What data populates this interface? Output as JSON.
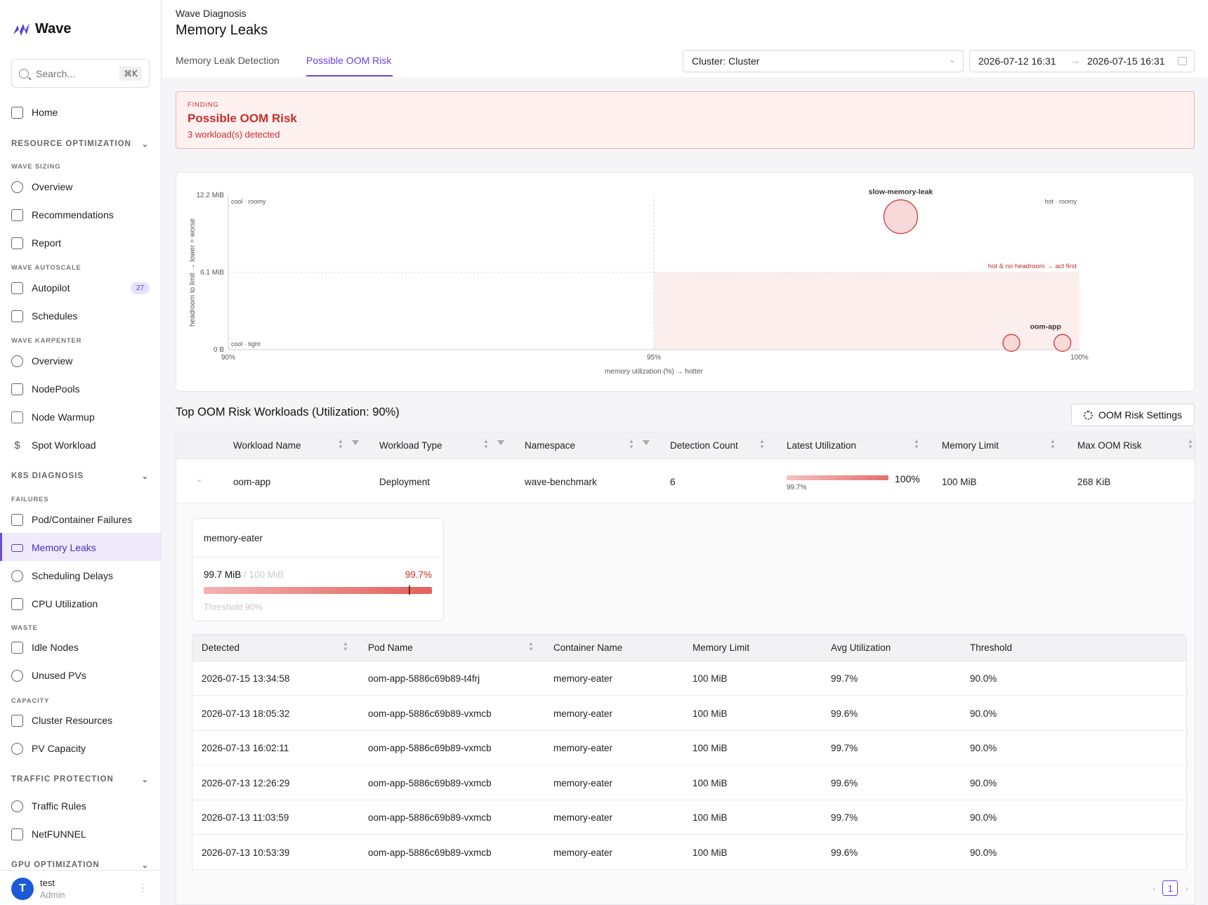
{
  "app": {
    "name": "Wave"
  },
  "search": {
    "placeholder": "Search...",
    "shortcut": "⌘K"
  },
  "sidebar": {
    "home": "Home",
    "resource_opt": "RESOURCE OPTIMIZATION",
    "wave_sizing": "WAVE SIZING",
    "overview1": "Overview",
    "recommendations": "Recommendations",
    "report": "Report",
    "wave_autoscale": "WAVE AUTOSCALE",
    "autopilot": "Autopilot",
    "autopilot_badge": "27",
    "schedules": "Schedules",
    "wave_karpenter": "WAVE KARPENTER",
    "overview2": "Overview",
    "nodepools": "NodePools",
    "node_warmup": "Node Warmup",
    "spot_workload": "Spot Workload",
    "k8s_diag": "K8S DIAGNOSIS",
    "failures": "FAILURES",
    "pod_failures": "Pod/Container Failures",
    "memory_leaks": "Memory Leaks",
    "scheduling_delays": "Scheduling Delays",
    "cpu_util": "CPU Utilization",
    "waste": "WASTE",
    "idle_nodes": "Idle Nodes",
    "unused_pvs": "Unused PVs",
    "capacity": "CAPACITY",
    "cluster_resources": "Cluster Resources",
    "pv_capacity": "PV Capacity",
    "traffic_protection": "TRAFFIC PROTECTION",
    "traffic_rules": "Traffic Rules",
    "netfunnel": "NetFUNNEL",
    "gpu_opt": "GPU OPTIMIZATION"
  },
  "user": {
    "initial": "T",
    "name": "test",
    "role": "Admin"
  },
  "header": {
    "breadcrumb": "Wave Diagnosis",
    "title": "Memory Leaks",
    "tabs": [
      "Memory Leak Detection",
      "Possible OOM Risk"
    ],
    "cluster": "Cluster: Cluster",
    "date_from": "2026-07-12 16:31",
    "date_to": "2026-07-15 16:31"
  },
  "finding": {
    "label": "FINDING",
    "title": "Possible OOM Risk",
    "subtitle": "3 workload(s) detected"
  },
  "chart_data": {
    "type": "scatter",
    "xlabel": "memory utilization (%) → hotter",
    "ylabel": "headroom to limit → lower = worse",
    "x_ticks": [
      "90%",
      "95%",
      "100%"
    ],
    "y_ticks": [
      "0 B",
      "6.1 MiB",
      "12.2 MiB"
    ],
    "xlim": [
      90,
      100
    ],
    "ylim": [
      0,
      12.2
    ],
    "quadrant_labels": {
      "top_left": "cool · roomy",
      "top_right": "hot · roomy",
      "bottom_left": "cool · tight",
      "danger": "hot & no headroom → act first"
    },
    "points": [
      {
        "label": "slow-memory-leak",
        "x": 97.9,
        "y": 10.5,
        "size": "large"
      },
      {
        "label": "",
        "x": 99.2,
        "y": 0.2,
        "size": "small"
      },
      {
        "label": "oom-app",
        "x": 99.8,
        "y": 0.2,
        "size": "small"
      }
    ]
  },
  "workloads": {
    "title": "Top OOM Risk Workloads (Utilization: 90%)",
    "settings_label": "OOM Risk Settings",
    "columns": [
      "Workload Name",
      "Workload Type",
      "Namespace",
      "Detection Count",
      "Latest Utilization",
      "Memory Limit",
      "Max OOM Risk"
    ],
    "row": {
      "name": "oom-app",
      "type": "Deployment",
      "namespace": "wave-benchmark",
      "count": "6",
      "util_small": "99.7%",
      "util_pct": "100%",
      "util_value": 1.0,
      "limit": "100 MiB",
      "max_risk": "268 KiB"
    }
  },
  "container": {
    "name": "memory-eater",
    "used": "99.7 MiB",
    "limit": "/ 100 MiB",
    "pct": "99.7%",
    "pct_value": 0.997,
    "threshold": "Threshold 90%"
  },
  "detections": {
    "columns": [
      "Detected",
      "Pod Name",
      "Container Name",
      "Memory Limit",
      "Avg Utilization",
      "Threshold"
    ],
    "rows": [
      [
        "2026-07-15 13:34:58",
        "oom-app-5886c69b89-t4frj",
        "memory-eater",
        "100 MiB",
        "99.7%",
        "90.0%"
      ],
      [
        "2026-07-13 18:05:32",
        "oom-app-5886c69b89-vxmcb",
        "memory-eater",
        "100 MiB",
        "99.6%",
        "90.0%"
      ],
      [
        "2026-07-13 16:02:11",
        "oom-app-5886c69b89-vxmcb",
        "memory-eater",
        "100 MiB",
        "99.7%",
        "90.0%"
      ],
      [
        "2026-07-13 12:26:29",
        "oom-app-5886c69b89-vxmcb",
        "memory-eater",
        "100 MiB",
        "99.6%",
        "90.0%"
      ],
      [
        "2026-07-13 11:03:59",
        "oom-app-5886c69b89-vxmcb",
        "memory-eater",
        "100 MiB",
        "99.7%",
        "90.0%"
      ],
      [
        "2026-07-13 10:53:39",
        "oom-app-5886c69b89-vxmcb",
        "memory-eater",
        "100 MiB",
        "99.6%",
        "90.0%"
      ]
    ]
  },
  "pagination": {
    "current": "1"
  }
}
